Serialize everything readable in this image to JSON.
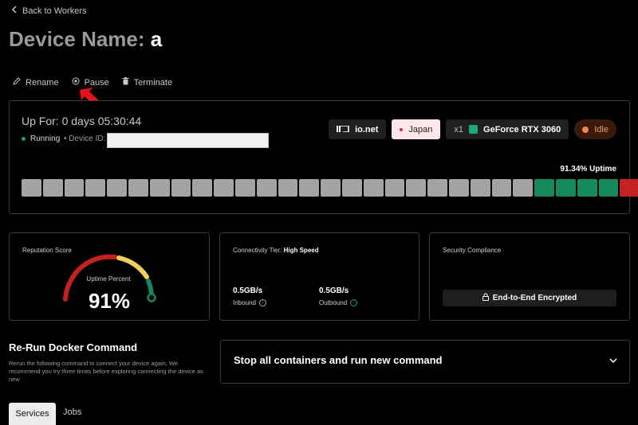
{
  "nav": {
    "back_label": "Back to Workers"
  },
  "header": {
    "title_prefix": "Device Name:",
    "title_value": "a"
  },
  "actions": {
    "rename": "Rename",
    "pause": "Pause",
    "terminate": "Terminate"
  },
  "status_panel": {
    "up_for": "Up For: 0 days 05:30:44",
    "state": "Running",
    "device_id_label": "• Device ID:",
    "device_id_value": "",
    "provider": "io.net",
    "location": "Japan",
    "gpu_count": "x1",
    "gpu_name": "GeForce RTX 3060",
    "activity": "Idle",
    "uptime_label": "91.34% Uptime",
    "history": [
      "gray",
      "gray",
      "gray",
      "gray",
      "gray",
      "gray",
      "gray",
      "gray",
      "gray",
      "gray",
      "gray",
      "gray",
      "gray",
      "gray",
      "gray",
      "gray",
      "gray",
      "gray",
      "gray",
      "gray",
      "gray",
      "gray",
      "gray",
      "gray",
      "green",
      "green",
      "green",
      "green",
      "red"
    ],
    "colors": {
      "gray": "#a4a4a4",
      "green": "#158a5e",
      "red": "#c42222",
      "accent_green": "#1f9e6c"
    }
  },
  "reputation": {
    "label": "Reputation Score",
    "sub_label": "Uptime Percent",
    "value": "91%",
    "score_fraction": 0.91
  },
  "connectivity": {
    "label": "Connectivity Tier:",
    "tier": "High Speed",
    "inbound_value": "0.5GB/s",
    "inbound_label": "Inbound",
    "outbound_value": "0.5GB/s",
    "outbound_label": "Outbound"
  },
  "security": {
    "label": "Security Compliance",
    "button": "End-to-End Encrypted"
  },
  "rerun": {
    "title": "Re-Run Docker Command",
    "description": "Rerun the following command to connect your device again, We recommend you try three times before exploring connecting the device as new"
  },
  "command_dropdown": {
    "selected": "Stop all containers and run new command"
  },
  "tabs": [
    {
      "label": "Services",
      "active": true
    },
    {
      "label": "Jobs",
      "active": false
    }
  ]
}
